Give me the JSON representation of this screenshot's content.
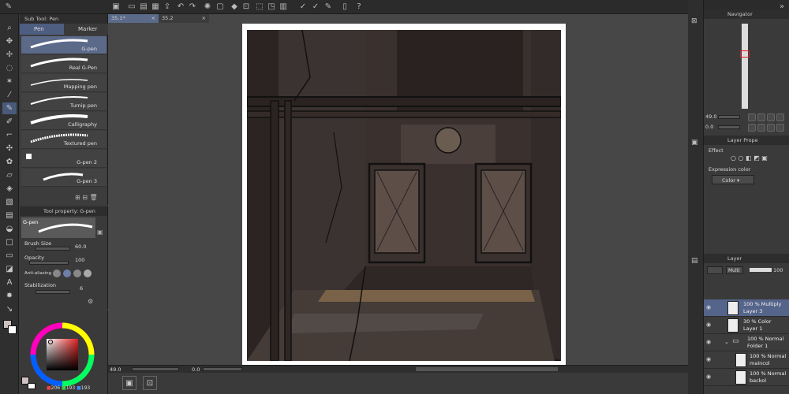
{
  "subtool": {
    "header": "Sub Tool: Pen",
    "tabs": [
      "Pen",
      "Marker"
    ],
    "brushes": [
      "G-pen",
      "Real G-Pen",
      "Mapping pen",
      "Turnip pen",
      "Calligraphy",
      "Textured pen",
      "G-pen 2",
      "G-pen 3"
    ]
  },
  "toolprop": {
    "header": "Tool property: G-pen",
    "brush_name": "G-pen",
    "brush_size_label": "Brush Size",
    "brush_size": "60.0",
    "opacity_label": "Opacity",
    "opacity": "100",
    "antialias_label": "Anti-aliasing",
    "stabilization_label": "Stabilization",
    "stabilization": "6"
  },
  "color": {
    "r": "206",
    "g": "193",
    "b": "193",
    "hue_ring_color": "#e02020",
    "selected_color": "#cec1c1"
  },
  "tabs": [
    "35.1*",
    "35.2"
  ],
  "status": {
    "zoom": "49.0",
    "angle": "0.0"
  },
  "navigator": {
    "title": "Navigator",
    "zoom": "49.0",
    "angle": "0.0"
  },
  "layerprop": {
    "title": "Layer Prope",
    "effect_label": "Effect",
    "expression_label": "Expression color",
    "expression_value": "Color"
  },
  "layers": {
    "title": "Layer",
    "blend": "Multi",
    "opacity": "100",
    "items": [
      {
        "line1": "100 % Multiply",
        "line2": "Layer 3",
        "selected": true
      },
      {
        "line1": "30 % Color",
        "line2": "Layer 1",
        "selected": false
      },
      {
        "line1": "100 % Normal",
        "line2": "Folder 1",
        "selected": false,
        "folder": true
      },
      {
        "line1": "100 % Normal",
        "line2": "maincol",
        "selected": false
      },
      {
        "line1": "100 % Normal",
        "line2": "backol",
        "selected": false
      }
    ]
  }
}
